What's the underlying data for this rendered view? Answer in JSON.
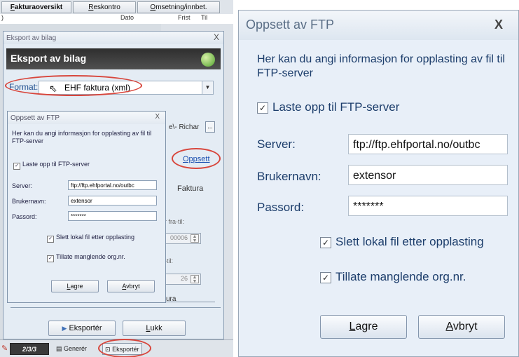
{
  "left": {
    "tabs": [
      "Fakturaoversikt",
      "Reskontro",
      "Omsetning/innbet."
    ],
    "columns": [
      "Dato",
      "Frist",
      "Til"
    ],
    "eksport": {
      "window_title": "Eksport av bilag",
      "close": "X",
      "header": "Eksport av bilag",
      "format_label": "Format:",
      "format_value": "EHF faktura (xml)",
      "path_fragment": "e\\- Richar",
      "browse": "...",
      "oppsett_link": "Oppsett",
      "faktura_label": "Faktura",
      "range_from_label": "r fra-til:",
      "range_from_value": "00006",
      "til_label": "-til:",
      "til_value": "26",
      "tura_label": "ura",
      "export_button": "Eksportér",
      "close_button": "Lukk"
    },
    "ftp_small": {
      "title": "Oppsett av FTP",
      "close": "X",
      "description": "Her kan du angi informasjon for opplasting av fil til FTP-server",
      "upload_check": "Laste opp til FTP-server",
      "server_label": "Server:",
      "server_value": "ftp://ftp.ehfportal.no/outbc",
      "user_label": "Brukernavn:",
      "user_value": "extensor",
      "pass_label": "Passord:",
      "pass_value": "*******",
      "delete_check": "Slett lokal fil etter opplasting",
      "allow_check": "Tillate manglende org.nr.",
      "save": "Lagre",
      "cancel": "Avbryt"
    },
    "bottom": {
      "logo": "2/3/3",
      "generer": "Generér",
      "eksporter": "Eksportér"
    }
  },
  "ftp_big": {
    "title": "Oppsett av FTP",
    "close": "X",
    "description": "Her kan du angi informasjon for opplasting av fil til FTP-server",
    "upload_check": "Laste opp til FTP-server",
    "server_label": "Server:",
    "server_value": "ftp://ftp.ehfportal.no/outbc",
    "user_label": "Brukernavn:",
    "user_value": "extensor",
    "pass_label": "Passord:",
    "pass_value": "*******",
    "delete_check": "Slett lokal fil etter opplasting",
    "allow_check": "Tillate manglende org.nr.",
    "save": "Lagre",
    "cancel": "Avbryt"
  },
  "colors": {
    "dialog_bg": "#e8eff8",
    "label_text": "#1c3d6b",
    "highlight_ellipse": "#d8463c"
  }
}
